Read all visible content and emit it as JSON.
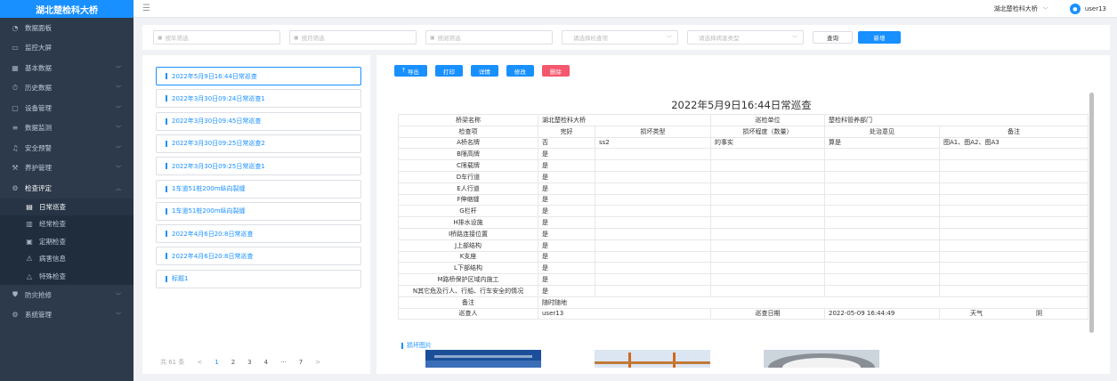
{
  "app": {
    "title": "湖北楚检科大桥"
  },
  "header": {
    "bridge_select": "湖北楚检科大桥",
    "username": "user13"
  },
  "sidebar": {
    "items": [
      {
        "label": "数据面板",
        "icon": "dashboard-icon"
      },
      {
        "label": "监控大屏",
        "icon": "monitor-icon"
      },
      {
        "label": "基本数据",
        "icon": "grid-icon"
      },
      {
        "label": "历史数据",
        "icon": "history-icon"
      },
      {
        "label": "设备管理",
        "icon": "device-icon"
      },
      {
        "label": "数据监测",
        "icon": "list-icon"
      },
      {
        "label": "安全预警",
        "icon": "bell-icon"
      },
      {
        "label": "养护管理",
        "icon": "maintenance-icon"
      },
      {
        "label": "检查评定",
        "icon": "settings-icon"
      }
    ],
    "subitems": [
      {
        "label": "日常巡查",
        "icon": "document-icon"
      },
      {
        "label": "经常检查",
        "icon": "chart-icon"
      },
      {
        "label": "定期检查",
        "icon": "calendar-icon"
      },
      {
        "label": "病害信息",
        "icon": "warning-icon"
      },
      {
        "label": "特殊检查",
        "icon": "alert-icon"
      }
    ],
    "bottom_items": [
      {
        "label": "防灾抢修",
        "icon": "shield-icon"
      },
      {
        "label": "系统管理",
        "icon": "system-icon"
      }
    ]
  },
  "filters": {
    "year_placeholder": "按年筛选",
    "month_placeholder": "按月筛选",
    "date_placeholder": "按阅筛选",
    "type_placeholder": "请选择检查项",
    "disease_placeholder": "请选择病害类型",
    "query_label": "查询",
    "add_label": "新增"
  },
  "list": {
    "items": [
      "2022年5月9日16:44日常巡查",
      "2022年3月30日09:24日常巡查1",
      "2022年3月30日09:45日常巡查",
      "2022年3月30日09:25日常巡查2",
      "2022年3月30日09:25日常巡查1",
      "1车道51桩200m纵向裂缝",
      "1车道51桩200m纵向裂缝",
      "2022年4月6日20:8日常巡查",
      "2022年4月6日20:8日常巡查",
      "标题1"
    ],
    "total": "共 61 条",
    "pages": [
      "1",
      "2",
      "3",
      "4",
      "···",
      "7"
    ],
    "prev": "<",
    "next": ">"
  },
  "actions": {
    "export": "导出",
    "print": "打印",
    "detail": "详情",
    "edit": "修改",
    "delete": "删除"
  },
  "report": {
    "title": "2022年5月9日16:44日常巡查",
    "bridge_name_label": "桥梁名称",
    "bridge_name": "湖北楚检科大桥",
    "unit_label": "巡检单位",
    "unit": "楚检科管养部门",
    "headers": [
      "检查项",
      "完好",
      "损坏类型",
      "损坏程度（数量）",
      "处治意见",
      "备注"
    ],
    "rows": [
      [
        "A桥名牌",
        "否",
        "ss2",
        "的事实",
        "算是",
        "图A1、图A2、图A3"
      ],
      [
        "B限高牌",
        "是",
        "",
        "",
        "",
        ""
      ],
      [
        "C限载牌",
        "是",
        "",
        "",
        "",
        ""
      ],
      [
        "D车行道",
        "是",
        "",
        "",
        "",
        ""
      ],
      [
        "E人行道",
        "是",
        "",
        "",
        "",
        ""
      ],
      [
        "F伸缩缝",
        "是",
        "",
        "",
        "",
        ""
      ],
      [
        "G栏杆",
        "是",
        "",
        "",
        "",
        ""
      ],
      [
        "H排水设施",
        "是",
        "",
        "",
        "",
        ""
      ],
      [
        "I桥路连接位置",
        "是",
        "",
        "",
        "",
        ""
      ],
      [
        "J上部结构",
        "是",
        "",
        "",
        "",
        ""
      ],
      [
        "K支座",
        "是",
        "",
        "",
        "",
        ""
      ],
      [
        "L下部结构",
        "是",
        "",
        "",
        "",
        ""
      ],
      [
        "M路桥保护区域内施工",
        "是",
        "",
        "",
        "",
        ""
      ],
      [
        "N其它危及行人、行船、行车安全的情况",
        "是",
        "",
        "",
        "",
        ""
      ]
    ],
    "remark_label": "备注",
    "remark": "随时随地",
    "inspector_label": "巡查人",
    "inspector": "user13",
    "date_label": "巡查日期",
    "date": "2022-05-09 16:44:49",
    "weather_label": "天气",
    "weather": "阴",
    "damage_images_label": "损坏图片"
  }
}
